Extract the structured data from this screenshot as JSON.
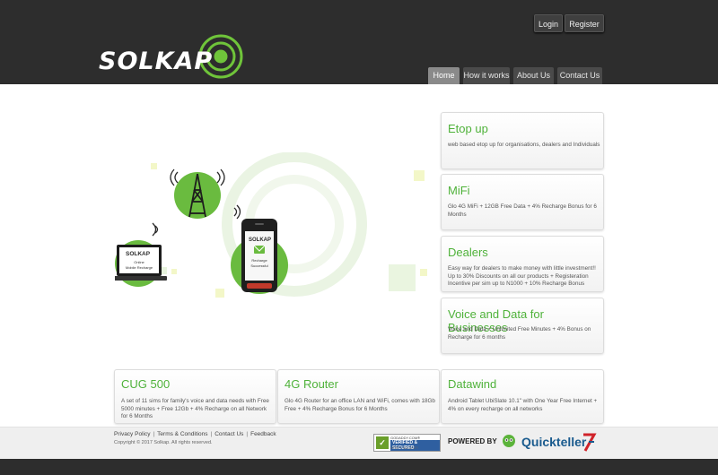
{
  "header": {
    "logo_text": "SOLKAP",
    "login_label": "Login",
    "register_label": "Register",
    "nav": [
      "Home",
      "How it works",
      "About Us",
      "Contact Us"
    ],
    "active_nav": "Home"
  },
  "hero": {
    "laptop_screen_logo": "SOLKAP",
    "laptop_caption_1": "Online",
    "laptop_caption_2": "Mobile Recharge",
    "phone_screen_logo": "SOLKAP",
    "phone_caption_1": "Recharge",
    "phone_caption_2": "Successful"
  },
  "side_cards": [
    {
      "title": "Etop up",
      "lines": [
        "web based etop up for organisations, dealers and Individuals"
      ]
    },
    {
      "title": "MiFi",
      "lines": [
        "Glo 4G MiFi + 12GB Free Data + 4% Recharge Bonus for 6",
        "Months"
      ]
    },
    {
      "title": "Dealers",
      "lines": [
        "Easy way for dealers to make money with little investment!!",
        "Up to 30% Discounts on all our products + Registeration",
        "Incentive per sim up to N1000 + 10% Recharge Bonus"
      ]
    },
    {
      "title": "Voice and Data for Businesses",
      "lines": [
        "Voice and Data + Unlimited Free Minutes + 4% Bonus on",
        "Recharge for 6 months"
      ]
    }
  ],
  "bottom_cards": [
    {
      "title": "CUG 500",
      "lines": [
        "A set of 11 sims for family's voice and data needs with Free",
        "5000 minutes + Free 12Gb + 4% Recharge on all Network",
        "for 6 Months"
      ]
    },
    {
      "title": "4G Router",
      "lines": [
        "Glo 4G Router for an office LAN and WiFi, comes with 18Gb",
        "Free + 4% Recharge Bonus for 6 Months"
      ]
    },
    {
      "title": "Datawind",
      "lines": [
        "Android Tablet UbiSlate 10.1\" with One Year Free Internet +",
        "4% on every recharge on all networks"
      ]
    }
  ],
  "footer": {
    "links": [
      "Privacy Policy",
      "Terms & Conditions",
      "Contact Us",
      "Feedback"
    ],
    "copyright": "Copyright © 2017 Solkap.  All rights reserved.",
    "seal_line1": "GODADDY.COM®",
    "seal_line2": "VERIFIED & SECURED",
    "seal_line3": "VERIFY SECURITY",
    "powered_by": "POWERED BY",
    "quickteller": "Quickteller"
  },
  "colors": {
    "brand_green": "#4fb23a",
    "header_bg": "#2d2d2d",
    "quickteller_blue": "#1a5b8e",
    "quickteller_red": "#d0232a"
  }
}
